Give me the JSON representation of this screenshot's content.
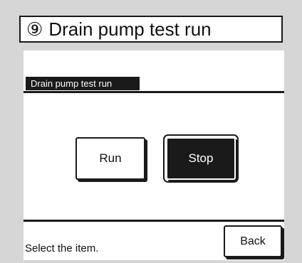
{
  "header": {
    "step_number": "⑨",
    "title": "Drain pump test run"
  },
  "section": {
    "label": "Drain pump test run"
  },
  "buttons": {
    "run_label": "Run",
    "stop_label": "Stop",
    "back_label": "Back"
  },
  "status": {
    "message": "Select the item."
  },
  "state": {
    "selected": "Stop"
  }
}
